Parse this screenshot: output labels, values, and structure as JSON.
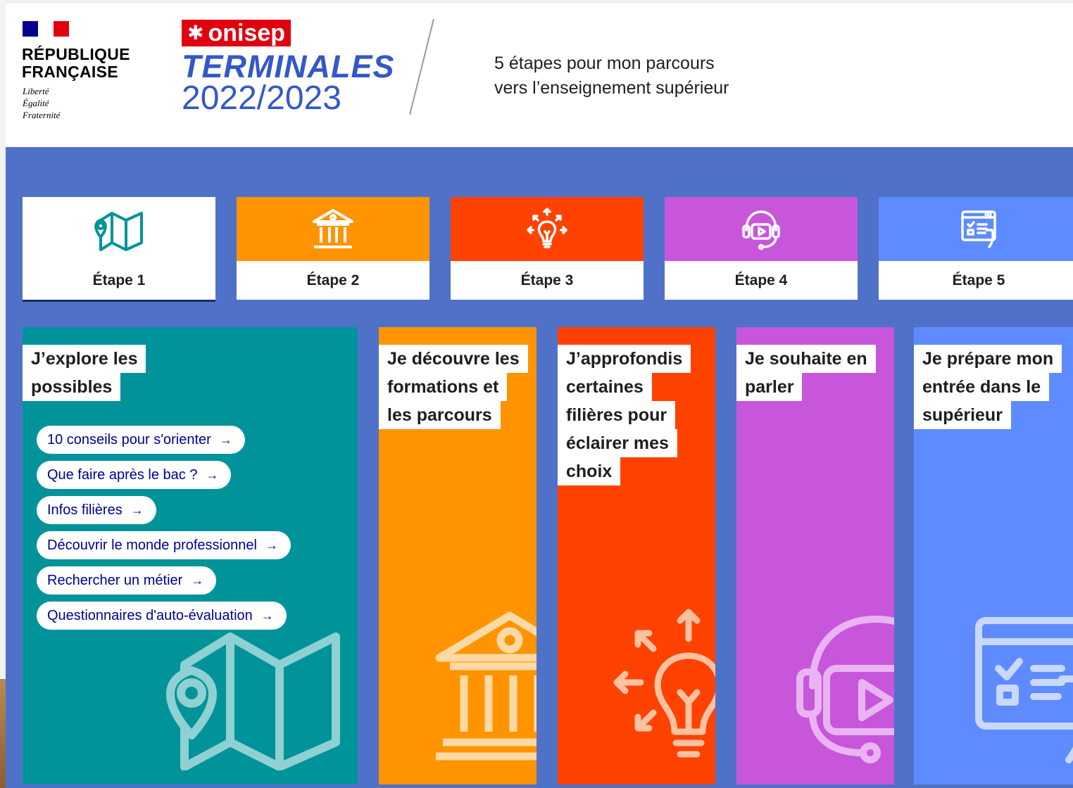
{
  "header": {
    "rf_name": "RÉPUBLIQUE\nFRANÇAISE",
    "motto": "Liberté\nÉgalité\nFraternité",
    "brand_badge": "onisep",
    "brand_badge_symbol": "✱",
    "brand_title": "TERMINALES",
    "brand_year": "2022/2023",
    "tagline": "5 étapes pour mon parcours\nvers l’enseignement supérieur"
  },
  "colors": {
    "teal": "#00939a",
    "orange": "#ff9400",
    "red": "#ff4200",
    "purple": "#c756db",
    "blue": "#5e8bff",
    "background": "#4f72c8",
    "link": "#000091"
  },
  "tabs": [
    {
      "label": "Étape 1",
      "icon": "map-icon",
      "active": true
    },
    {
      "label": "Étape 2",
      "icon": "institution-icon",
      "active": false
    },
    {
      "label": "Étape 3",
      "icon": "lightbulb-icon",
      "active": false
    },
    {
      "label": "Étape 4",
      "icon": "headset-video-icon",
      "active": false
    },
    {
      "label": "Étape 5",
      "icon": "browser-checklist-icon",
      "active": false
    }
  ],
  "panels": [
    {
      "title_lines": [
        "J’explore les",
        "possibles"
      ],
      "links": [
        "10 conseils pour s'orienter",
        "Que faire après le bac ?",
        "Infos filières",
        "Découvrir le monde professionnel",
        "Rechercher un métier",
        "Questionnaires d'auto-évaluation"
      ]
    },
    {
      "title_lines": [
        "Je découvre les",
        "formations et",
        "les parcours"
      ]
    },
    {
      "title_lines": [
        "J’approfondis",
        "certaines",
        "filières pour",
        "éclairer mes",
        "choix"
      ]
    },
    {
      "title_lines": [
        "Je souhaite en",
        "parler"
      ]
    },
    {
      "title_lines": [
        "Je prépare mon",
        "entrée dans le",
        "supérieur"
      ]
    }
  ],
  "link_arrow": "→"
}
